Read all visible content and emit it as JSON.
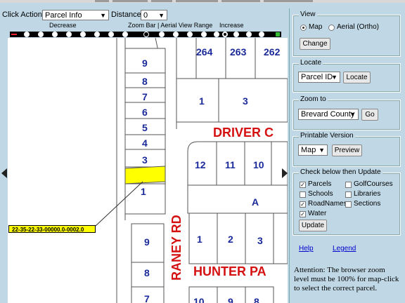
{
  "toolbar": {
    "click_action_label": "Click Action:",
    "click_action_value": "Parcel Info",
    "distance_label": "Distance",
    "distance_value": "0"
  },
  "zoom_bar": {
    "decrease_label": "Decrease",
    "center_label": "Zoom Bar | Aerial View Range",
    "increase_label": "Increase",
    "minus_color": "#e22222",
    "plus_color": "#33bb33"
  },
  "map": {
    "parcel_numbers_left": [
      "9",
      "8",
      "7",
      "6",
      "5",
      "4",
      "3",
      "1"
    ],
    "parcel_numbers_left_lower": [
      "9",
      "8",
      "7"
    ],
    "parcel_numbers_top": [
      "264",
      "263",
      "262"
    ],
    "parcel_numbers_mid": [
      "1",
      "3"
    ],
    "parcel_numbers_block": [
      "12",
      "11",
      "10"
    ],
    "parcel_block_label": "A",
    "parcel_numbers_lower": [
      "1",
      "2",
      "3"
    ],
    "parcel_numbers_bottom": [
      "10",
      "9",
      "8"
    ],
    "street_driver": "DRIVER C",
    "street_raney": "RANEY RD",
    "street_hunter": "HUNTER PA",
    "selected_parcel_id": "22-35-22-33-00000.0-0002.0",
    "selected_color": "#ffff00"
  },
  "panel": {
    "view": {
      "title": "View",
      "map_label": "Map",
      "aerial_label": "Aerial (Ortho)",
      "selected": "Map",
      "change_button": "Change"
    },
    "locate": {
      "title": "Locate",
      "select_value": "Parcel ID",
      "button": "Locate"
    },
    "zoom_to": {
      "title": "Zoom to",
      "select_value": "Brevard County",
      "button": "Go"
    },
    "printable": {
      "title": "Printable Version",
      "select_value": "Map",
      "button": "Preview"
    },
    "layers": {
      "title": "Check below then Update",
      "items": [
        {
          "label": "Parcels",
          "checked": true
        },
        {
          "label": "GolfCourses",
          "checked": false
        },
        {
          "label": "Schools",
          "checked": false
        },
        {
          "label": "Libraries",
          "checked": false
        },
        {
          "label": "RoadNames",
          "checked": true
        },
        {
          "label": "Sections",
          "checked": false
        },
        {
          "label": "Water",
          "checked": true
        }
      ],
      "update_button": "Update"
    },
    "help_link": "Help",
    "legend_link": "Legend",
    "note": "Attention: The browser zoom level must be 100% for map-click to select the correct parcel."
  }
}
